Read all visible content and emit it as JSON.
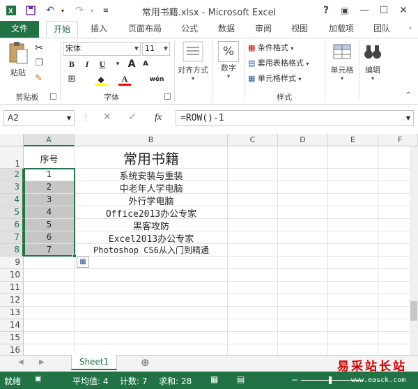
{
  "window": {
    "title": "常用书籍.xlsx - Microsoft Excel",
    "help": "?",
    "ribbon_toggle": "▣",
    "minimize": "—",
    "maximize": "☐",
    "close": "✕"
  },
  "tabs": [
    "文件",
    "开始",
    "插入",
    "页面布局",
    "公式",
    "数据",
    "审阅",
    "视图",
    "加载项",
    "团队"
  ],
  "ribbon": {
    "clipboard": {
      "paste": "粘贴",
      "group": "剪贴板"
    },
    "font": {
      "name": "宋体",
      "size": "11",
      "bold": "B",
      "italic": "I",
      "underline": "U",
      "grow": "A",
      "shrink": "A",
      "color_a": "A",
      "pinyin": "wén",
      "group": "字体"
    },
    "alignment": {
      "label": "对齐方式"
    },
    "number": {
      "symbol": "%",
      "label": "数字"
    },
    "styles": {
      "conditional": "条件格式",
      "table": "套用表格格式",
      "cell_styles": "单元格样式",
      "group": "样式"
    },
    "cells": {
      "label": "单元格"
    },
    "editing": {
      "label": "编辑"
    }
  },
  "formula_bar": {
    "name_box": "A2",
    "fx": "fx",
    "formula": "=ROW()-1"
  },
  "columns": [
    "A",
    "B",
    "C",
    "D",
    "E",
    "F"
  ],
  "rows": [
    "1",
    "2",
    "3",
    "4",
    "5",
    "6",
    "7",
    "8",
    "9",
    "10",
    "11",
    "12",
    "13",
    "14",
    "15",
    "16"
  ],
  "cells": {
    "A1": "序号",
    "B1": "常用书籍",
    "colA": [
      "1",
      "2",
      "3",
      "4",
      "5",
      "6",
      "7"
    ],
    "colB": [
      "系统安装与重装",
      "中老年人学电脑",
      "外行学电脑",
      "Office2013办公专家",
      "黑客攻防",
      "Excel2013办公专家",
      "Photoshop CS6从入门到精通"
    ]
  },
  "sheets": [
    "Sheet1"
  ],
  "add_sheet": "⊕",
  "status": {
    "mode": "就绪",
    "average": "平均值: 4",
    "count": "计数: 7",
    "sum": "求和: 28"
  },
  "watermark": {
    "brand": "易采站长站",
    "url": "www.easck.com"
  },
  "colors": {
    "excel_green": "#217346",
    "selection_fill": "#c6c6c6",
    "header_bg": "#f3f3f3"
  }
}
